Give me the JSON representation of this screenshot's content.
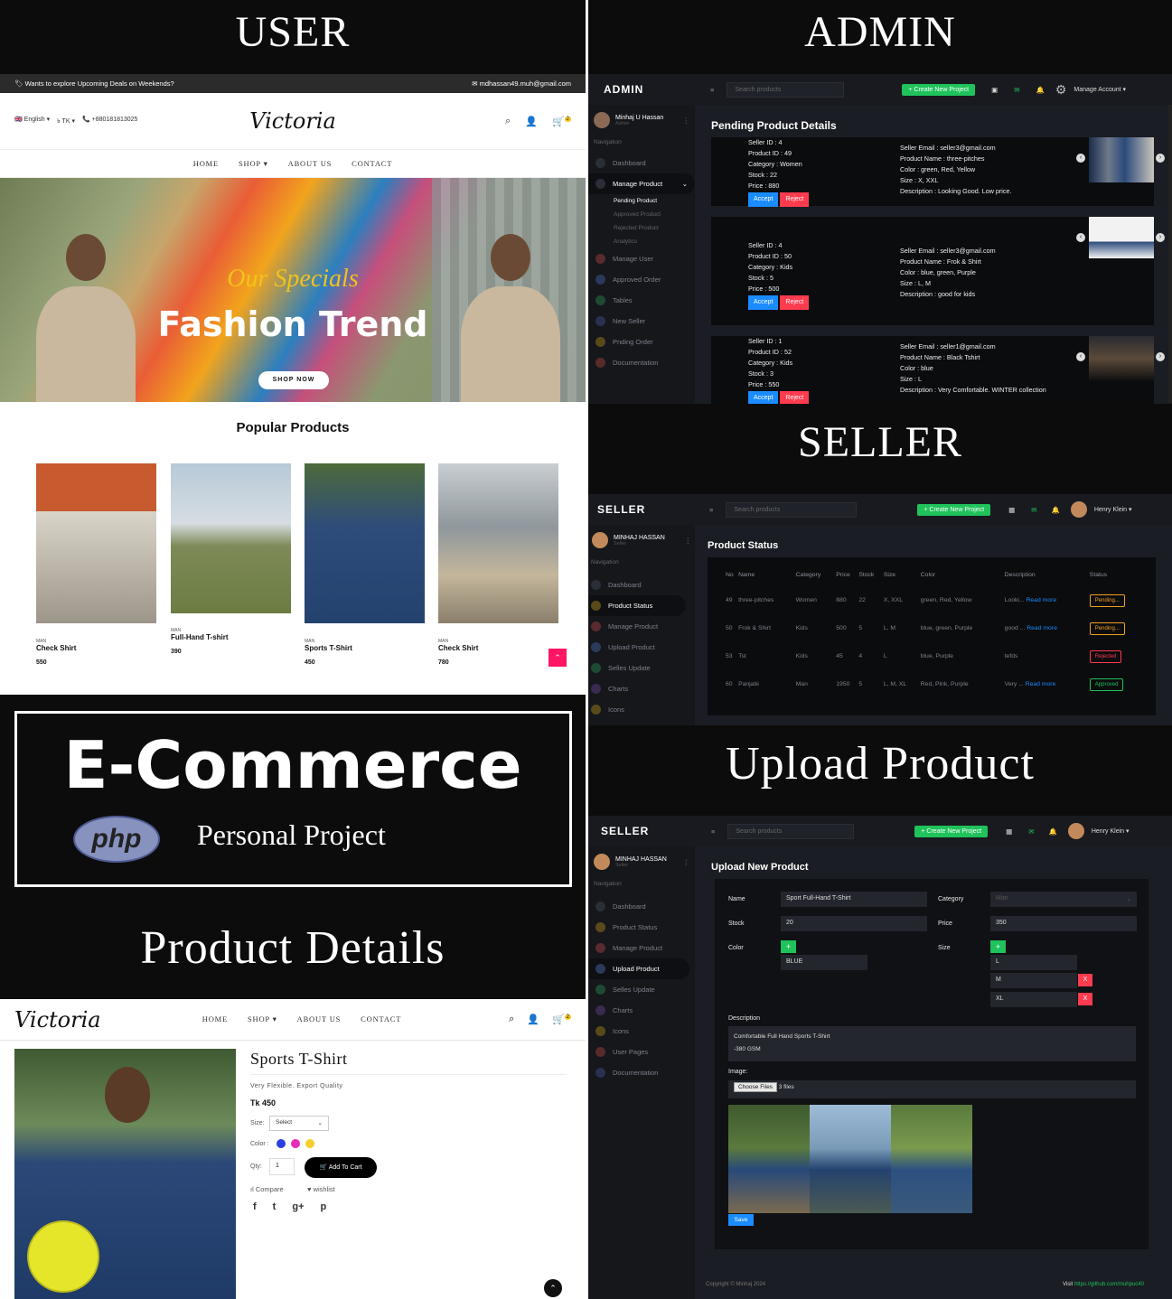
{
  "headers": {
    "user": "USER",
    "admin": "ADMIN",
    "seller": "SELLER",
    "upload": "Upload Product",
    "details": "Product Details"
  },
  "project": {
    "title": "E-Commerce",
    "php": "php",
    "subtitle": "Personal Project"
  },
  "user": {
    "topbar_left": "Wants to explore Upcoming Deals on Weekends?",
    "topbar_email": "mdhassan49.muh@gmail.com",
    "lang": "English",
    "currency": "TK",
    "phone": "+880181813025",
    "logo": "Victoria",
    "cart_count": "2",
    "nav": [
      "HOME",
      "SHOP",
      "ABOUT US",
      "CONTACT"
    ],
    "hero_script": "Our Specials",
    "hero_title": "Fashion Trend",
    "hero_button": "SHOP NOW",
    "popular_title": "Popular Products",
    "products": [
      {
        "cat": "MAN",
        "name": "Check Shirt",
        "price": "550"
      },
      {
        "cat": "MAN",
        "name": "Full-Hand T-shirt",
        "price": "390"
      },
      {
        "cat": "MAN",
        "name": "Sports T-Shirt",
        "price": "450"
      },
      {
        "cat": "MAN",
        "name": "Check Shirt",
        "price": "780"
      }
    ]
  },
  "admin": {
    "brand": "ADMIN",
    "search_placeholder": "Search products",
    "create_btn": "+ Create New Project",
    "account": "Manage Account",
    "user_name": "Minhaj U Hassan",
    "user_role": "Admin",
    "nav_heading": "Navigation",
    "nav": [
      "Dashboard",
      "Manage Product",
      "Manage User",
      "Approved Order",
      "Tables",
      "New Seller",
      "Pnding Order",
      "Documentation"
    ],
    "sub_nav": [
      "Pending Product",
      "Approved Product",
      "Rejected Product",
      "Analytics"
    ],
    "page_title": "Pending Product Details",
    "accept": "Accept",
    "reject": "Reject",
    "items": [
      {
        "seller_id": "Seller ID : 4",
        "product_id": "Product ID : 49",
        "category": "Category : Women",
        "stock": "Stock : 22",
        "price": "Price : 880",
        "email": "Seller Email : seller3@gmail.com",
        "name": "Product Name : three-pitches",
        "color": "Color : green, Red, Yellow",
        "size": "Size : X, XXL",
        "desc": "Description : Looking Good. Low price."
      },
      {
        "seller_id": "Seller ID : 4",
        "product_id": "Product ID : 50",
        "category": "Category : Kids",
        "stock": "Stock : 5",
        "price": "Price : 500",
        "email": "Seller Email : seller3@gmail.com",
        "name": "Product Name : Frok & Shirt",
        "color": "Color : blue, green, Purple",
        "size": "Size : L, M",
        "desc": "Description : good for kids"
      },
      {
        "seller_id": "Seller ID : 1",
        "product_id": "Product ID : 52",
        "category": "Category : Kids",
        "stock": "Stock : 3",
        "price": "Price : 550",
        "email": "Seller Email : seller1@gmail.com",
        "name": "Product Name : Black Tshirt",
        "color": "Color : blue",
        "size": "Size : L",
        "desc": "Description : Very Comfortable. WINTER collection"
      }
    ]
  },
  "seller": {
    "brand": "SELLER",
    "search_placeholder": "Search products",
    "create_btn": "+ Create New Project",
    "account": "Henry Klein",
    "user_name": "MINHAJ HASSAN",
    "user_role": "Seller",
    "nav_heading": "Navigation",
    "nav": [
      "Dashboard",
      "Product Status",
      "Manage Product",
      "Upload Product",
      "Selles Update",
      "Charts",
      "Icons"
    ],
    "page_title": "Product Status",
    "columns": [
      "No",
      "Name",
      "Category",
      "Price",
      "Stock",
      "Size",
      "Color",
      "Description",
      "Status"
    ],
    "read_more": "Read more",
    "rows": [
      {
        "no": "49",
        "name": "three-pitches",
        "category": "Women",
        "price": "880",
        "stock": "22",
        "size": "X, XXL",
        "color": "green, Red, Yellow",
        "desc": "Looki...",
        "status": "Pending...",
        "status_color": "#f0a020"
      },
      {
        "no": "50",
        "name": "Frok & Shirt",
        "category": "Kids",
        "price": "500",
        "stock": "5",
        "size": "L, M",
        "color": "blue, green, Purple",
        "desc": "good ...",
        "status": "Pending...",
        "status_color": "#f0a020"
      },
      {
        "no": "53",
        "name": "Tst",
        "category": "Kids",
        "price": "45",
        "stock": "4",
        "size": "L",
        "color": "blue, Purple",
        "desc": "tefds",
        "status": "Rejected",
        "status_color": "#ff3b4e"
      },
      {
        "no": "60",
        "name": "Panjabi",
        "category": "Man",
        "price": "1950",
        "stock": "5",
        "size": "L, M, XL",
        "color": "Red, Pink, Purple",
        "desc": "Very ...",
        "status": "Approved",
        "status_color": "#1fc25b"
      }
    ]
  },
  "upload": {
    "brand": "SELLER",
    "search_placeholder": "Search products",
    "create_btn": "+ Create New Project",
    "account": "Henry Klein",
    "user_name": "MINHAJ HASSAN",
    "user_role": "Seller",
    "nav_heading": "Navigation",
    "nav": [
      "Dashboard",
      "Product Status",
      "Manage Product",
      "Upload Product",
      "Selles Update",
      "Charts",
      "Icons",
      "User Pages",
      "Documentation"
    ],
    "page_title": "Upload New Product",
    "name_label": "Name",
    "name_value": "Sport Full-Hand T-Shirt",
    "category_label": "Category",
    "category_value": "Man",
    "stock_label": "Stock",
    "stock_value": "20",
    "price_label": "Price",
    "price_value": "350",
    "color_label": "Color",
    "color_value": "BLUE",
    "size_label": "Size",
    "sizes": [
      "L",
      "M",
      "XL"
    ],
    "desc_label": "Description",
    "desc_line1": "Comfortable Full Hand Sports T-Shirt",
    "desc_line2": "-380 GSM",
    "image_label": "Image:",
    "choose_files": "Choose Files",
    "files_count": "3 files",
    "save": "Save",
    "footer_left": "Copyright © Minhaj 2024",
    "footer_visit": "Visit",
    "footer_link": "https://github.com/muhpuc40"
  },
  "details": {
    "logo": "Victoria",
    "nav": [
      "HOME",
      "SHOP",
      "ABOUT US",
      "CONTACT"
    ],
    "cart_count": "2",
    "title": "Sports T-Shirt",
    "tagline": "Very Flexible. Export Quality",
    "price": "Tk 450",
    "size_label": "Size:",
    "size_select": "Select",
    "color_label": "Color :",
    "colors": [
      "#2b3fe0",
      "#e52cb8",
      "#f8d02c"
    ],
    "qty_label": "Qty:",
    "qty_value": "1",
    "add_to_cart": "Add To Cart",
    "compare": "Compare",
    "wishlist": "wishlist",
    "social": [
      "f",
      "t",
      "g+",
      "p"
    ]
  }
}
